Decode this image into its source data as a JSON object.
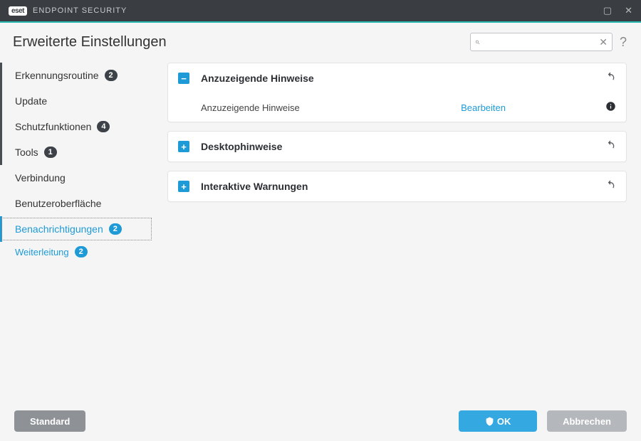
{
  "titlebar": {
    "brand_badge": "eset",
    "brand_text": "ENDPOINT SECURITY"
  },
  "header": {
    "title": "Erweiterte Einstellungen",
    "search_placeholder": "",
    "help_label": "?"
  },
  "sidebar": {
    "items": [
      {
        "label": "Erkennungsroutine",
        "badge": "2",
        "badge_style": "dark",
        "bar": true
      },
      {
        "label": "Update",
        "bar": true
      },
      {
        "label": "Schutzfunktionen",
        "badge": "4",
        "badge_style": "dark",
        "bar": true
      },
      {
        "label": "Tools",
        "badge": "1",
        "badge_style": "dark",
        "bar": true
      },
      {
        "label": "Verbindung"
      },
      {
        "label": "Benutzeroberfläche"
      },
      {
        "label": "Benachrichtigungen",
        "badge": "2",
        "badge_style": "blue",
        "active": true
      }
    ],
    "sub": {
      "label": "Weiterleitung",
      "badge": "2",
      "badge_style": "blue"
    }
  },
  "panels": {
    "expanded": {
      "title": "Anzuzeigende Hinweise",
      "row_label": "Anzuzeigende Hinweise",
      "row_action": "Bearbeiten"
    },
    "collapsed": [
      {
        "title": "Desktophinweise"
      },
      {
        "title": "Interaktive Warnungen"
      }
    ]
  },
  "footer": {
    "default_btn": "Standard",
    "ok_btn": "OK",
    "cancel_btn": "Abbrechen"
  }
}
